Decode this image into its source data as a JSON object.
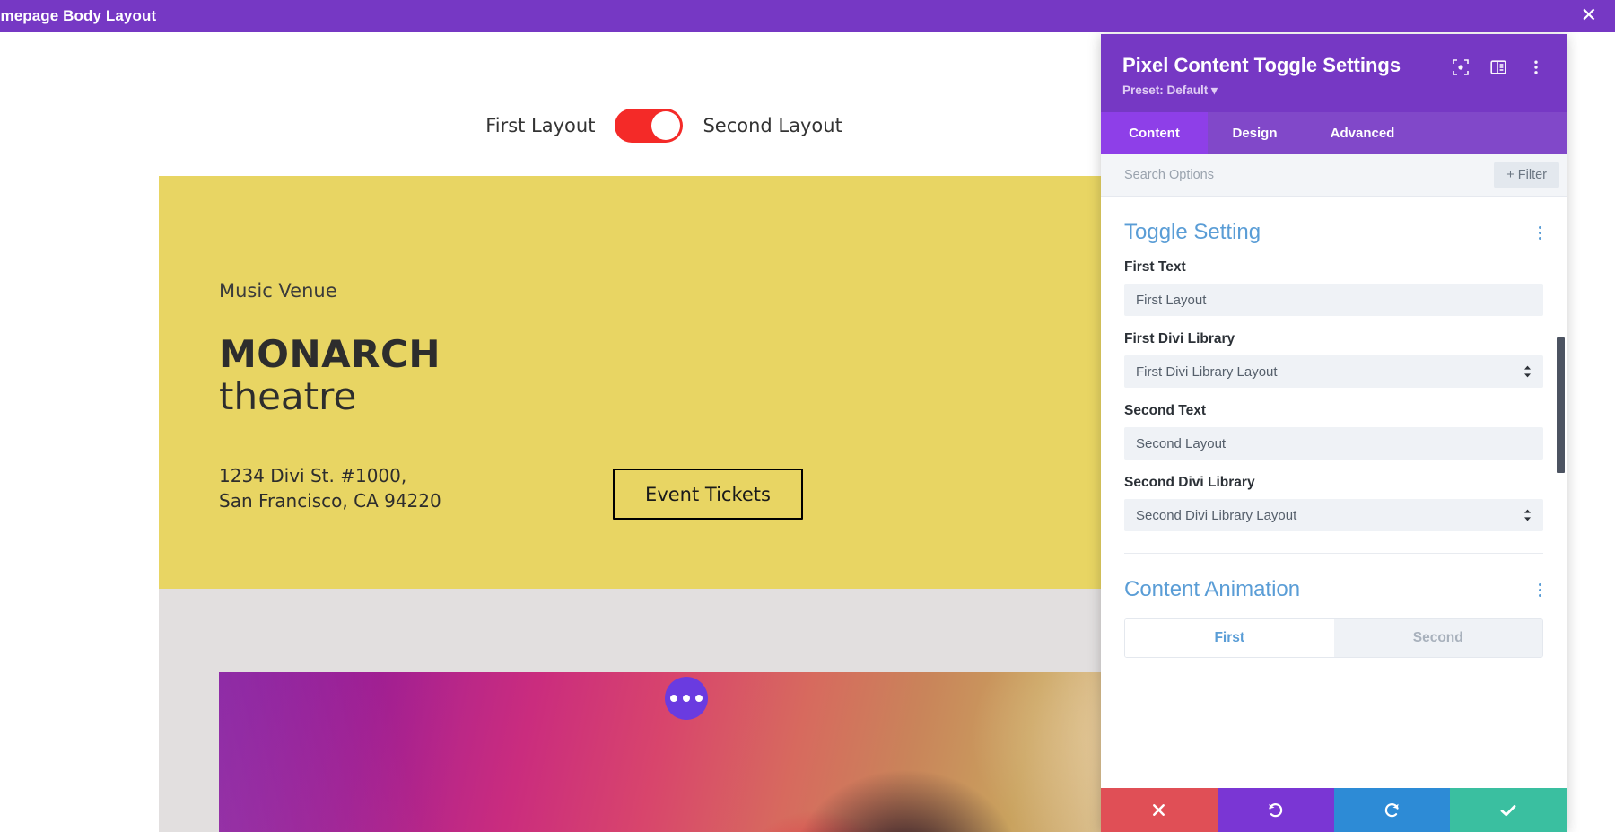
{
  "topbar": {
    "title": "omepage Body Layout",
    "close_icon": "close-icon"
  },
  "canvas": {
    "toggle": {
      "first_label": "First Layout",
      "second_label": "Second Layout",
      "state": "second",
      "track_color": "#F42A28",
      "knob_color": "#FFFFFF"
    },
    "hero": {
      "background_color": "#E8D563",
      "eyebrow": "Music Venue",
      "title_line1": "MONARCH",
      "title_line2": "theatre",
      "address": "1234 Divi St. #1000,\nSan Francisco, CA 94220",
      "cta_label": "Event Tickets"
    },
    "grey_band_color": "#E2DFDF",
    "photo": {
      "dots_button_label": "module-actions",
      "dots_button_color": "#6A3BE0"
    }
  },
  "panel": {
    "title": "Pixel Content Toggle Settings",
    "preset": "Preset: Default",
    "header_icons": [
      {
        "name": "focus-target-icon"
      },
      {
        "name": "panel-layout-icon"
      },
      {
        "name": "vertical-dots-icon"
      }
    ],
    "tabs": [
      {
        "label": "Content",
        "active": true
      },
      {
        "label": "Design",
        "active": false
      },
      {
        "label": "Advanced",
        "active": false
      }
    ],
    "search": {
      "placeholder": "Search Options",
      "value": "",
      "filter_label": "Filter",
      "filter_plus": "+"
    },
    "sections": [
      {
        "title": "Toggle Setting",
        "fields": [
          {
            "type": "text",
            "label": "First Text",
            "value": "First Layout"
          },
          {
            "type": "select",
            "label": "First Divi Library",
            "value": "First Divi Library Layout"
          },
          {
            "type": "text",
            "label": "Second Text",
            "value": "Second Layout"
          },
          {
            "type": "select",
            "label": "Second Divi Library",
            "value": "Second Divi Library Layout"
          }
        ]
      },
      {
        "title": "Content Animation",
        "segmented": [
          {
            "label": "First",
            "active": true
          },
          {
            "label": "Second",
            "active": false
          }
        ]
      }
    ],
    "footer": [
      {
        "name": "cancel-button",
        "icon": "close-icon",
        "color": "#E04F56"
      },
      {
        "name": "undo-button",
        "icon": "undo-icon",
        "color": "#7A36D4"
      },
      {
        "name": "redo-button",
        "icon": "redo-icon",
        "color": "#2D8BD6"
      },
      {
        "name": "save-button",
        "icon": "check-icon",
        "color": "#3ABFA0"
      }
    ],
    "accent_color": "#7638C4",
    "section_title_color": "#5A9DD6"
  }
}
